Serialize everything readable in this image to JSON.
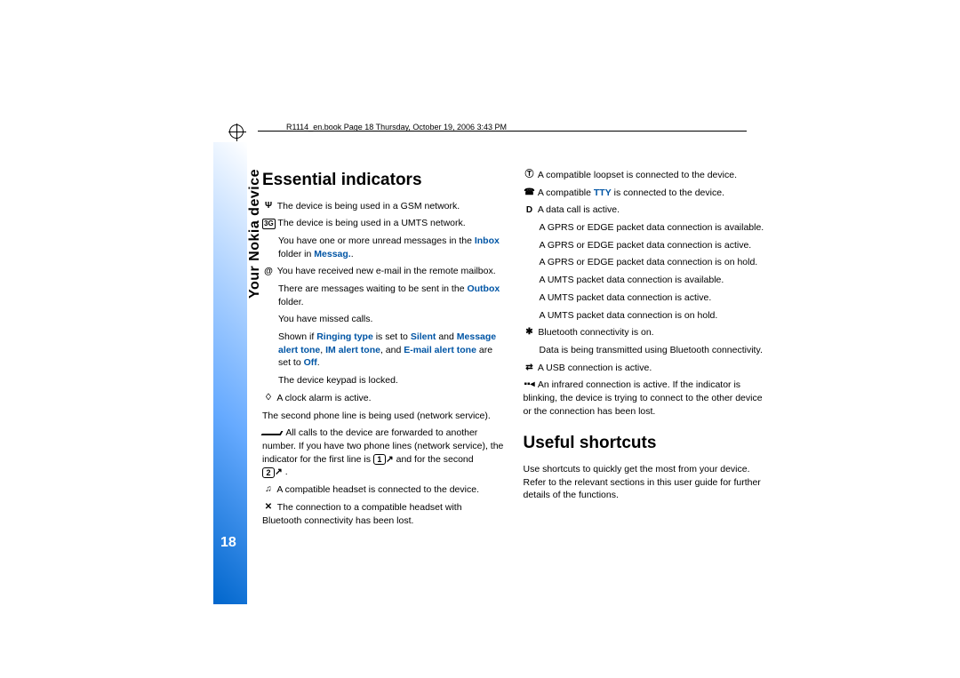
{
  "header": {
    "crop_info": "R1114_en.book  Page 18  Thursday, October 19, 2006  3:43 PM"
  },
  "sidebar": {
    "section": "Your Nokia device",
    "page_number": "18"
  },
  "col1": {
    "heading": "Essential indicators",
    "items": {
      "gsm": "The device is being used in a GSM network.",
      "umts": "The device is being used in a UMTS network.",
      "unread_a": "You have one or more unread messages in the ",
      "unread_link": "Inbox",
      "unread_b": " folder in ",
      "unread_link2": "Messag.",
      "unread_c": ".",
      "email": "You have received new e-mail in the remote mailbox.",
      "outbox_a": "There are messages waiting to be sent in the ",
      "outbox_link": "Outbox",
      "outbox_b": " folder.",
      "missed": "You have missed calls.",
      "ringing_a": "Shown if ",
      "ringing_l1": "Ringing type",
      "ringing_b": " is set to ",
      "ringing_l2": "Silent",
      "ringing_c": " and ",
      "ringing_l3": "Message alert tone",
      "ringing_d": ", ",
      "ringing_l4": "IM alert tone",
      "ringing_e": ", and ",
      "ringing_l5": "E-mail alert tone",
      "ringing_f": " are set to ",
      "ringing_l6": "Off",
      "ringing_g": ".",
      "keypad": "The device keypad is locked.",
      "alarm": "A clock alarm is active.",
      "second_line": "The second phone line is being used (network service).",
      "forward_a": "All calls to the device are forwarded to another number. If you have two phone lines (network service), the indicator for the first line is ",
      "forward_b": " and for the second ",
      "forward_c": ".",
      "headset": "A compatible headset is connected to the device.",
      "bt_headset": "The connection to a compatible headset with Bluetooth connectivity has been lost."
    }
  },
  "col2": {
    "items": {
      "loopset": "A compatible loopset is connected to the device.",
      "tty_a": "A compatible ",
      "tty_link": "TTY",
      "tty_b": " is connected to the device.",
      "data_call": "A data call is active.",
      "gprs_avail": "A GPRS or EDGE packet data connection is available.",
      "gprs_active": "A GPRS or EDGE packet data connection is active.",
      "gprs_hold": "A GPRS or EDGE packet data connection is on hold.",
      "umts_avail": "A UMTS packet data connection is available.",
      "umts_active": "A UMTS packet data connection is active.",
      "umts_hold": "A UMTS packet data connection is on hold.",
      "bt_on": "Bluetooth connectivity is on.",
      "bt_data": "Data is being transmitted using Bluetooth connectivity.",
      "usb": "A USB connection is active.",
      "ir": "An infrared connection is active. If the indicator is blinking, the device is trying to connect to the other device or the connection has been lost."
    },
    "heading2": "Useful shortcuts",
    "shortcuts_text": "Use shortcuts to quickly get the most from your device. Refer to the relevant sections in this user guide for further details of the functions."
  }
}
